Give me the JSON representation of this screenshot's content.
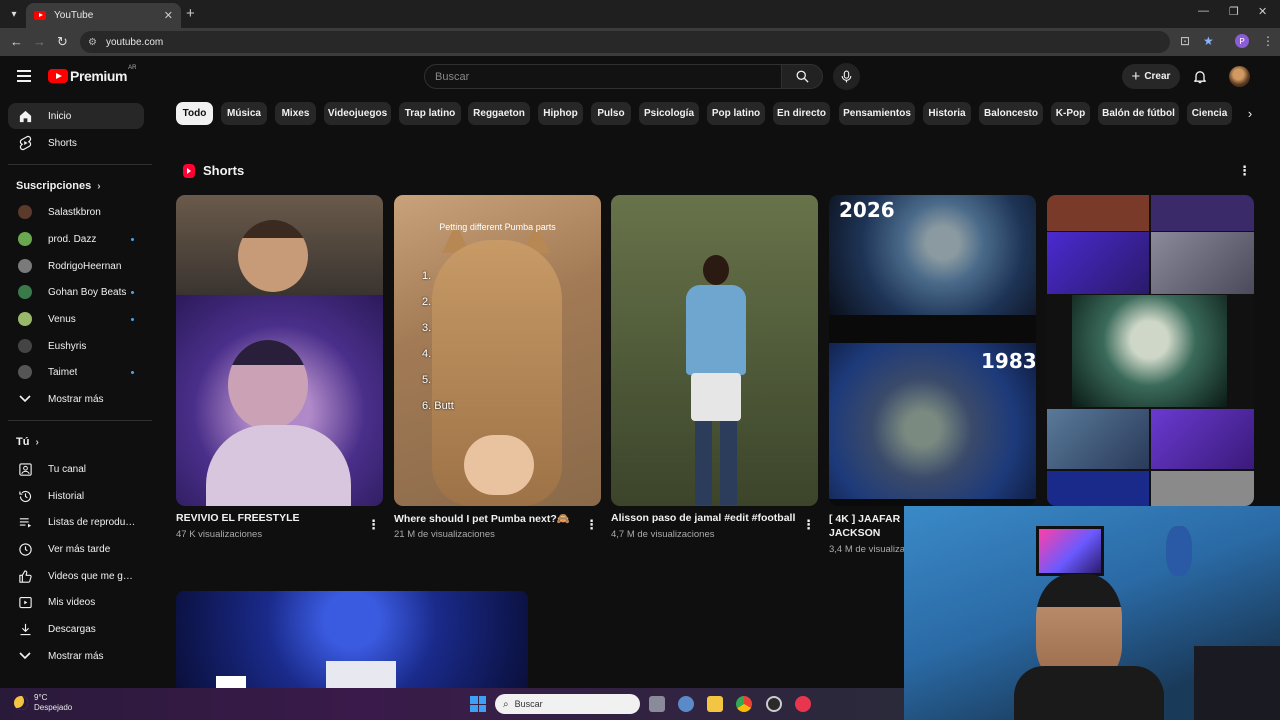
{
  "browser": {
    "tab_title": "YouTube",
    "url": "youtube.com",
    "profile_initial": "P"
  },
  "masthead": {
    "logo_text": "Premium",
    "country_code": "AR",
    "search_placeholder": "Buscar",
    "create_label": "Crear"
  },
  "sidebar": {
    "main": [
      {
        "label": "Inicio",
        "icon": "home-icon"
      },
      {
        "label": "Shorts",
        "icon": "shorts-icon"
      }
    ],
    "subscriptions_title": "Suscripciones",
    "subscriptions": [
      {
        "label": "Salastkbron",
        "color": "#5a3a2a",
        "new": false
      },
      {
        "label": "prod. Dazz",
        "color": "#6aa84f",
        "new": true
      },
      {
        "label": "RodrigoHeernan",
        "color": "#7a7a7a",
        "new": false
      },
      {
        "label": "Gohan Boy Beats",
        "color": "#3a7a4a",
        "new": true
      },
      {
        "label": "Venus",
        "color": "#9ab86a",
        "new": true
      },
      {
        "label": "Eushyris",
        "color": "#444444",
        "new": false
      },
      {
        "label": "Taimet",
        "color": "#555555",
        "new": true
      }
    ],
    "show_more": "Mostrar más",
    "you_title": "Tú",
    "you_items": [
      {
        "label": "Tu canal",
        "icon": "channel-icon"
      },
      {
        "label": "Historial",
        "icon": "history-icon"
      },
      {
        "label": "Listas de reproducción",
        "icon": "playlists-icon"
      },
      {
        "label": "Ver más tarde",
        "icon": "watch-later-icon"
      },
      {
        "label": "Videos que me gustan",
        "icon": "like-icon"
      },
      {
        "label": "Mis videos",
        "icon": "my-videos-icon"
      },
      {
        "label": "Descargas",
        "icon": "download-icon"
      },
      {
        "label": "Mostrar más",
        "icon": "chevron-down-icon"
      }
    ]
  },
  "chips": [
    "Todo",
    "Música",
    "Mixes",
    "Videojuegos",
    "Trap latino",
    "Reggaeton",
    "Hiphop",
    "Pulso",
    "Psicología",
    "Pop latino",
    "En directo",
    "Pensamientos",
    "Historia",
    "Baloncesto",
    "K-Pop",
    "Balón de fútbol",
    "Ciencia"
  ],
  "shorts": {
    "section_title": "Shorts",
    "items": [
      {
        "title": "REVIVIO EL FREESTYLE",
        "views": "47 K visualizaciones"
      },
      {
        "title": "Where should I pet Pumba next?🙈",
        "views": "21 M de visualizaciones",
        "overlay_title": "Petting different Pumba parts",
        "overlay_list": [
          "1.",
          "2.",
          "3.",
          "4.",
          "5.",
          "6. Butt"
        ]
      },
      {
        "title": "Alisson paso de jamal #edit #football",
        "views": "4,7 M de visualizaciones"
      },
      {
        "title": "[ 4K ] JAAFAR JACKSON",
        "views": "3,4 M de visualizaciones",
        "overlay_year_1": "2026",
        "overlay_year_2": "1983"
      },
      {
        "title": "",
        "views": ""
      }
    ]
  },
  "taskbar": {
    "temperature": "9°C",
    "condition": "Despejado",
    "search_placeholder": "Buscar"
  }
}
